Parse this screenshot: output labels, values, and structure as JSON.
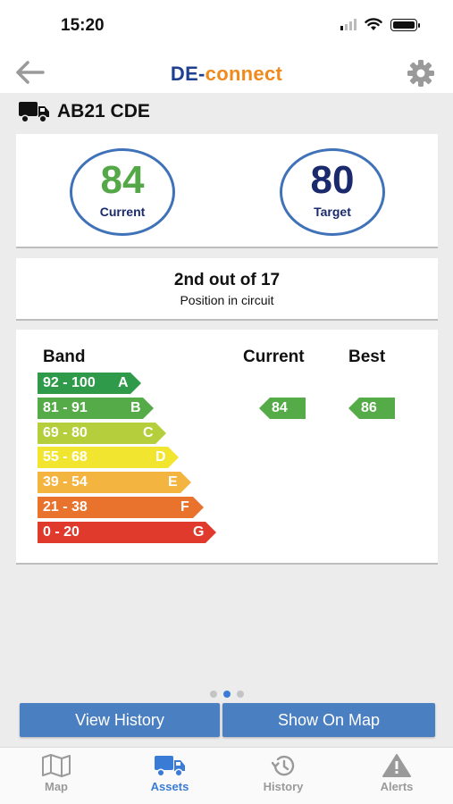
{
  "status_bar": {
    "time": "15:20"
  },
  "header": {
    "logo_part1": "DE-",
    "logo_part2": "connect"
  },
  "vehicle": {
    "registration": "AB21 CDE"
  },
  "scores": {
    "current": {
      "value": "84",
      "label": "Current"
    },
    "target": {
      "value": "80",
      "label": "Target"
    }
  },
  "position": {
    "title": "2nd out of 17",
    "subtitle": "Position in circuit"
  },
  "band_table": {
    "headers": {
      "band": "Band",
      "current": "Current",
      "best": "Best"
    },
    "bands": [
      {
        "range": "92 - 100",
        "letter": "A",
        "color": "#2e9a4a"
      },
      {
        "range": "81 - 91",
        "letter": "B",
        "color": "#55ab47"
      },
      {
        "range": "69 - 80",
        "letter": "C",
        "color": "#b5cf3c"
      },
      {
        "range": "55 - 68",
        "letter": "D",
        "color": "#f2e530"
      },
      {
        "range": "39 - 54",
        "letter": "E",
        "color": "#f4b440"
      },
      {
        "range": "21 - 38",
        "letter": "F",
        "color": "#e9722c"
      },
      {
        "range": "0 - 20",
        "letter": "G",
        "color": "#e03a2c"
      }
    ],
    "current_value": "84",
    "best_value": "86",
    "marker_color": "#55ab47"
  },
  "pager": {
    "pages": 3,
    "active_index": 1
  },
  "buttons": {
    "view_history": "View History",
    "show_on_map": "Show On Map"
  },
  "tabs": [
    {
      "label": "Map",
      "icon": "map-icon",
      "active": false
    },
    {
      "label": "Assets",
      "icon": "truck-icon",
      "active": true
    },
    {
      "label": "History",
      "icon": "history-icon",
      "active": false
    },
    {
      "label": "Alerts",
      "icon": "alert-icon",
      "active": false
    }
  ],
  "colors": {
    "accent": "#3a7bd5",
    "button": "#4a7fc1",
    "circle_border": "#3f72b8"
  }
}
